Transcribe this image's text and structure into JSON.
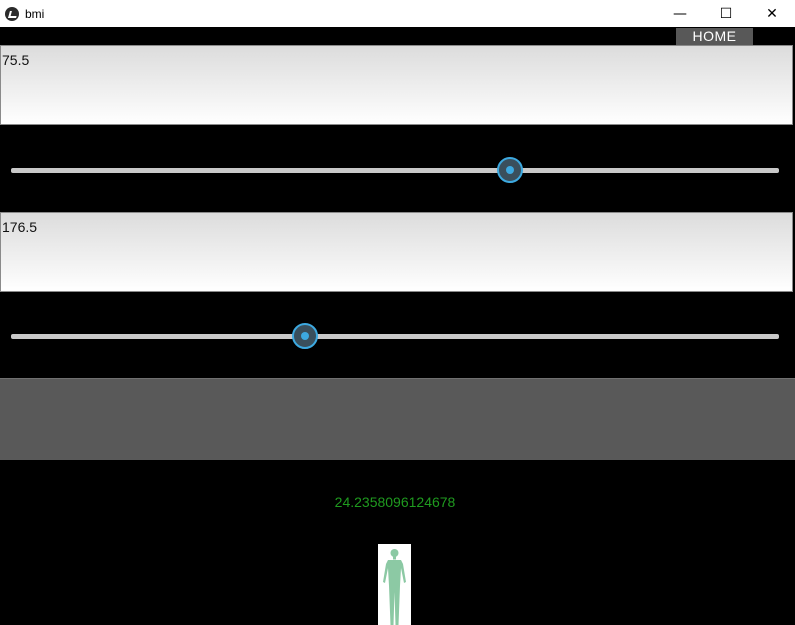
{
  "window": {
    "title": "bmi",
    "controls": {
      "minimize": "—",
      "maximize": "☐",
      "close": "✕"
    }
  },
  "header": {
    "home_label": "HOME"
  },
  "weight": {
    "value": "75.5",
    "slider_fraction": 0.65
  },
  "height": {
    "value": "176.5",
    "slider_fraction": 0.383
  },
  "calculate": {
    "label": ""
  },
  "result": {
    "bmi": "24.2358096124678",
    "color": "#1f9a1f"
  },
  "figure": {
    "icon": "human-body-icon"
  },
  "colors": {
    "accent": "#3da9e0",
    "background": "#000000"
  }
}
